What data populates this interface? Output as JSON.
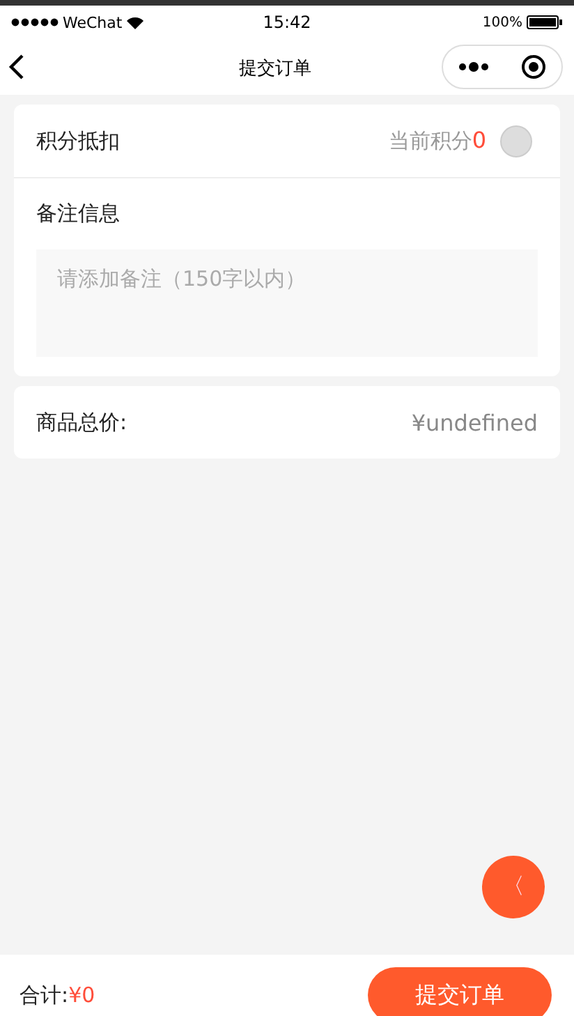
{
  "status_bar": {
    "carrier": "WeChat",
    "time": "15:42",
    "battery": "100%"
  },
  "nav": {
    "title": "提交订单"
  },
  "points": {
    "label": "积分抵扣",
    "current_label": "当前积分",
    "current_value": "0",
    "on": false
  },
  "remark": {
    "label": "备注信息",
    "placeholder": "请添加备注（150字以内）"
  },
  "total_price": {
    "label": "商品总价:",
    "value": "¥undefined"
  },
  "float_button": {
    "glyph": "〈"
  },
  "footer": {
    "label": "合计:",
    "amount": "¥0",
    "submit": "提交订单"
  }
}
